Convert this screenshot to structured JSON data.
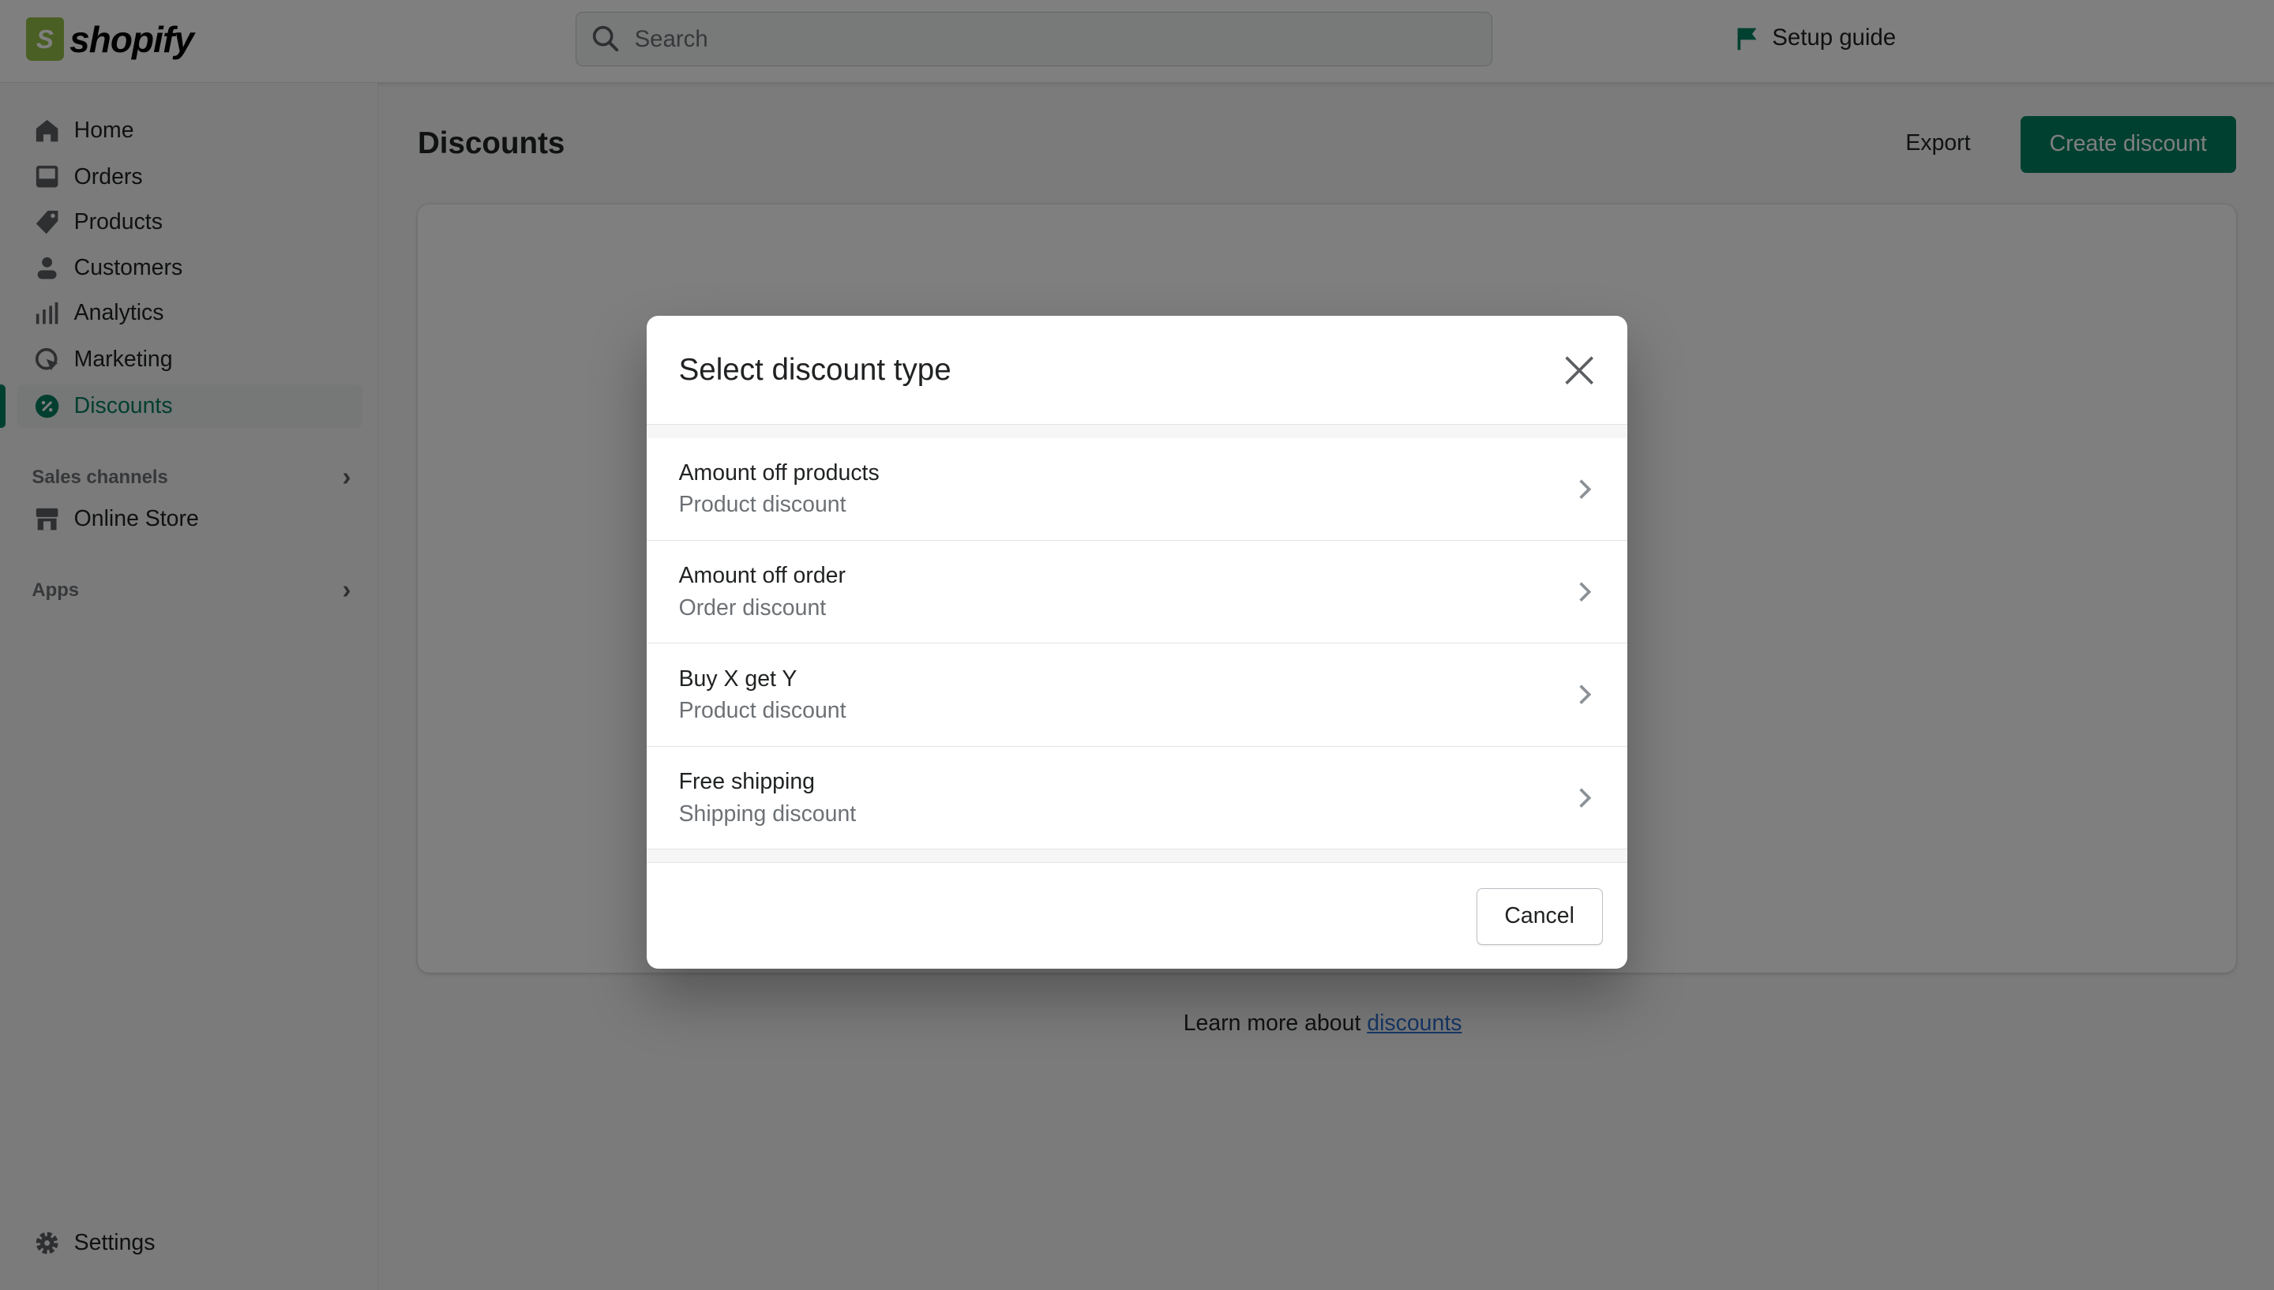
{
  "brand": {
    "name": "shopify",
    "logo_letter": "S",
    "color": "#95bf47"
  },
  "search": {
    "placeholder": "Search"
  },
  "setup_guide": "Setup guide",
  "sidebar": {
    "items": [
      {
        "label": "Home",
        "icon": "home-icon"
      },
      {
        "label": "Orders",
        "icon": "inbox-icon"
      },
      {
        "label": "Products",
        "icon": "tag-icon"
      },
      {
        "label": "Customers",
        "icon": "person-icon"
      },
      {
        "label": "Analytics",
        "icon": "bar-chart-icon"
      },
      {
        "label": "Marketing",
        "icon": "target-icon"
      },
      {
        "label": "Discounts",
        "icon": "discount-icon",
        "active": true
      }
    ],
    "sales_channels": "Sales channels",
    "online_store": "Online Store",
    "apps": "Apps",
    "settings": "Settings"
  },
  "page": {
    "title": "Discounts",
    "export": "Export",
    "create": "Create discount",
    "learn_prefix": "Learn more about ",
    "learn_link": "discounts",
    "accent": "#008060"
  },
  "modal": {
    "title": "Select discount type",
    "options": [
      {
        "title": "Amount off products",
        "subtitle": "Product discount"
      },
      {
        "title": "Amount off order",
        "subtitle": "Order discount"
      },
      {
        "title": "Buy X get Y",
        "subtitle": "Product discount"
      },
      {
        "title": "Free shipping",
        "subtitle": "Shipping discount"
      }
    ],
    "cancel": "Cancel"
  }
}
